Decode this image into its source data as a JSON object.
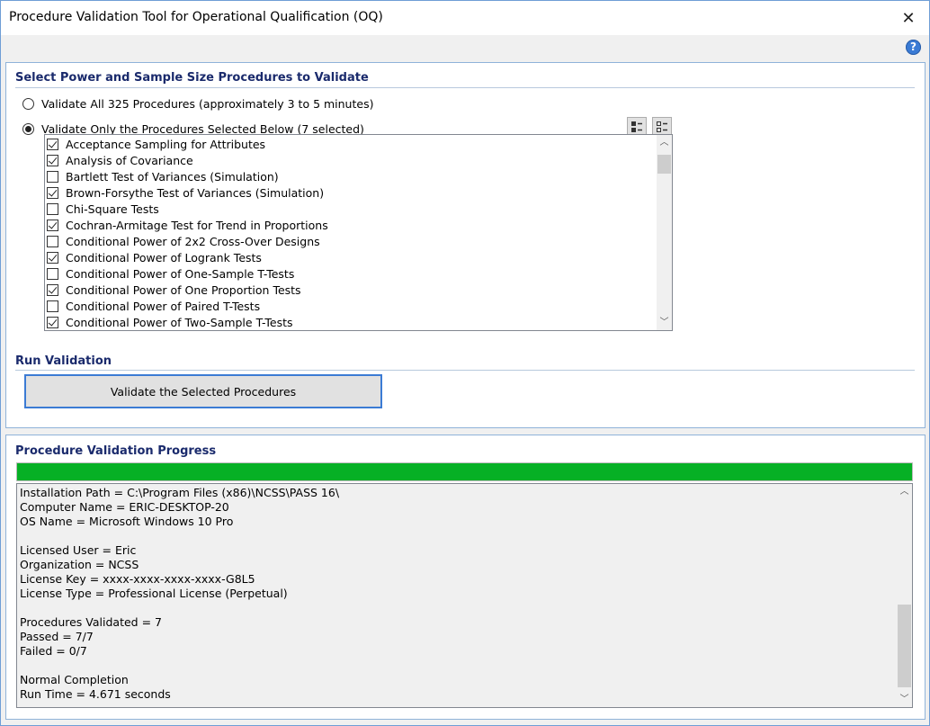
{
  "window": {
    "title": "Procedure Validation Tool for Operational Qualification (OQ)",
    "close_glyph": "✕",
    "help_glyph": "?"
  },
  "select_section": {
    "title": "Select Power and Sample Size Procedures to Validate",
    "radio_all_label": "Validate All 325 Procedures (approximately 3 to 5 minutes)",
    "radio_selected_label": "Validate Only the Procedures Selected Below (7 selected)",
    "selected_option": "selected",
    "procedures": [
      {
        "label": "Acceptance Sampling for Attributes",
        "checked": true
      },
      {
        "label": "Analysis of Covariance",
        "checked": true
      },
      {
        "label": "Bartlett Test of Variances (Simulation)",
        "checked": false
      },
      {
        "label": "Brown-Forsythe Test of Variances (Simulation)",
        "checked": true
      },
      {
        "label": "Chi-Square Tests",
        "checked": false
      },
      {
        "label": "Cochran-Armitage Test for Trend in Proportions",
        "checked": true
      },
      {
        "label": "Conditional Power of 2x2 Cross-Over Designs",
        "checked": false
      },
      {
        "label": "Conditional Power of Logrank Tests",
        "checked": true
      },
      {
        "label": "Conditional Power of One-Sample T-Tests",
        "checked": false
      },
      {
        "label": "Conditional Power of One Proportion Tests",
        "checked": true
      },
      {
        "label": "Conditional Power of Paired T-Tests",
        "checked": false
      },
      {
        "label": "Conditional Power of Two-Sample T-Tests",
        "checked": true
      }
    ]
  },
  "run_section": {
    "title": "Run Validation",
    "button_label": "Validate the Selected Procedures"
  },
  "progress_section": {
    "title": "Procedure Validation Progress",
    "progress_fraction": 1.0,
    "progress_color": "#06b025",
    "log_lines": [
      "Installation Path = C:\\Program Files (x86)\\NCSS\\PASS 16\\",
      "Computer Name = ERIC-DESKTOP-20",
      "OS Name = Microsoft Windows 10 Pro",
      "",
      "Licensed User = Eric",
      "Organization = NCSS",
      "License Key = xxxx-xxxx-xxxx-xxxx-G8L5",
      "License Type = Professional License (Perpetual)",
      "",
      "Procedures Validated = 7",
      "Passed = 7/7",
      "Failed = 0/7",
      "",
      "Normal Completion",
      "Run Time = 4.671 seconds"
    ]
  },
  "scroll_glyphs": {
    "up": "︿",
    "down": "﹀"
  }
}
